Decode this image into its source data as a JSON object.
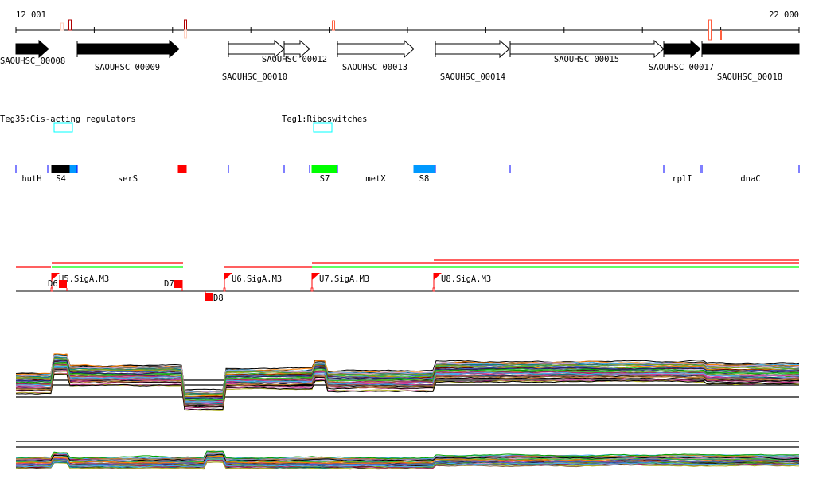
{
  "axis": {
    "start_label": "12 001",
    "end_label": "22 000"
  },
  "genes": [
    {
      "label": "SAOUHSC_00008",
      "filled": true
    },
    {
      "label": "SAOUHSC_00009",
      "filled": true
    },
    {
      "label": "SAOUHSC_00010",
      "filled": false
    },
    {
      "label": "SAOUHSC_00012",
      "filled": false
    },
    {
      "label": "SAOUHSC_00013",
      "filled": false
    },
    {
      "label": "SAOUHSC_00014",
      "filled": false
    },
    {
      "label": "SAOUHSC_00015",
      "filled": false
    },
    {
      "label": "SAOUHSC_00017",
      "filled": true
    },
    {
      "label": "SAOUHSC_00018",
      "filled": true
    }
  ],
  "regulators": [
    {
      "label": "Teg35:Cis-acting regulators",
      "color": "#00ffff"
    },
    {
      "label": "Teg1:Riboswitches",
      "color": "#00ffff"
    }
  ],
  "features": [
    {
      "label": "hutH",
      "fill": "#ffffff"
    },
    {
      "label": "S4",
      "fill": "#000000"
    },
    {
      "label": "",
      "fill": "#0099ff"
    },
    {
      "label": "serS",
      "fill": "#ffffff"
    },
    {
      "label": "",
      "fill": "#ff0000"
    },
    {
      "label": "",
      "fill": "#ffffff"
    },
    {
      "label": "",
      "fill": "#ffffff"
    },
    {
      "label": "S7",
      "fill": "#00ff00"
    },
    {
      "label": "metX",
      "fill": "#ffffff"
    },
    {
      "label": "S8",
      "fill": "#0099ff"
    },
    {
      "label": "",
      "fill": "#ffffff"
    },
    {
      "label": "",
      "fill": "#ffffff"
    },
    {
      "label": "rplI",
      "fill": "#ffffff"
    },
    {
      "label": "dnaC",
      "fill": "#ffffff"
    }
  ],
  "promoters": [
    {
      "label": "U5.SigA.M3"
    },
    {
      "label": "U6.SigA.M3"
    },
    {
      "label": "U7.SigA.M3"
    },
    {
      "label": "U8.SigA.M3"
    }
  ],
  "terminators": [
    {
      "label": "D6"
    },
    {
      "label": "D7"
    },
    {
      "label": "D8"
    }
  ],
  "colors": {
    "feature_outline": "#0000ff",
    "marker_red": "#ff0000",
    "green_line": "#00ff00",
    "axis": "#000000"
  }
}
